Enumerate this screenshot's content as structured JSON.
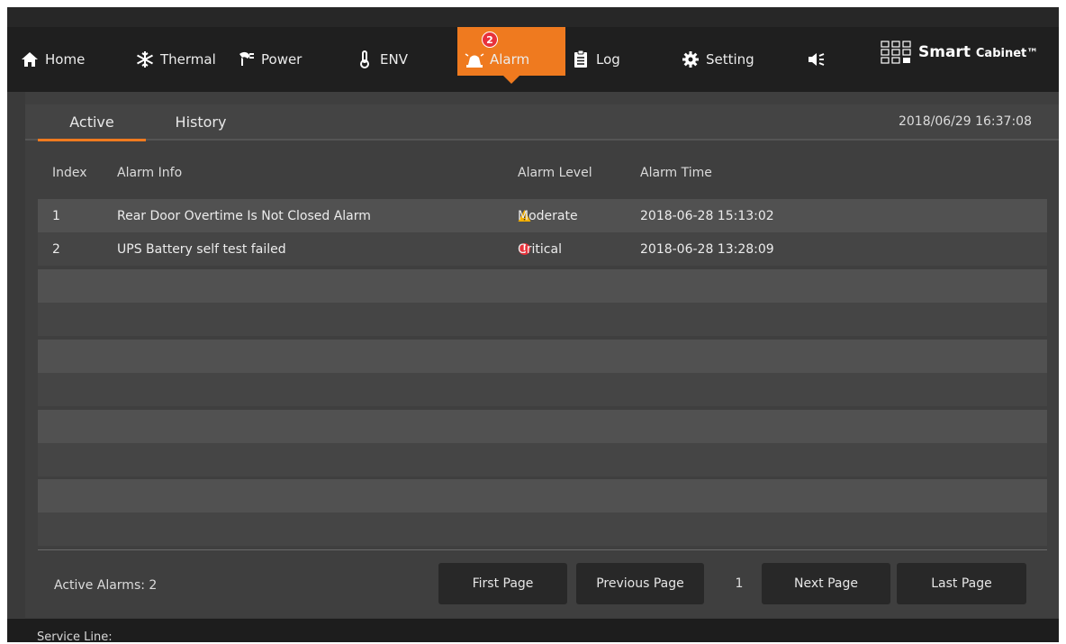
{
  "nav": {
    "items": [
      {
        "label": "Home",
        "icon": "home-icon"
      },
      {
        "label": "Thermal",
        "icon": "snowflake-icon"
      },
      {
        "label": "Power",
        "icon": "plug-icon"
      },
      {
        "label": "ENV",
        "icon": "thermometer-icon"
      },
      {
        "label": "Alarm",
        "icon": "siren-icon",
        "active": true
      },
      {
        "label": "Log",
        "icon": "clipboard-icon"
      },
      {
        "label": "Setting",
        "icon": "gear-icon"
      }
    ],
    "alarm_badge": "2",
    "sound_icon": "speaker-mute-icon",
    "brand": {
      "smart": "Smart",
      "cabinet": "Cabinet™"
    },
    "accent_color": "#ef7a1f"
  },
  "tabs": [
    {
      "label": "Active",
      "active": true
    },
    {
      "label": "History",
      "active": false
    }
  ],
  "datetime": "2018/06/29 16:37:08",
  "table": {
    "columns": [
      "Index",
      "Alarm Info",
      "Alarm Level",
      "Alarm Time"
    ],
    "rows": [
      {
        "index": "1",
        "info": "Rear Door Overtime Is Not Closed Alarm",
        "level": "Moderate",
        "level_icon": "warning-triangle-icon",
        "time": "2018-06-28 15:13:02"
      },
      {
        "index": "2",
        "info": "UPS Battery self test failed",
        "level": "Critical",
        "level_icon": "critical-exclamation-icon",
        "time": "2018-06-28 13:28:09"
      }
    ]
  },
  "footer": {
    "active_alarms": "Active Alarms: 2",
    "first_page": "First Page",
    "previous_page": "Previous Page",
    "page_number": "1",
    "next_page": "Next Page",
    "last_page": "Last Page"
  },
  "service_line": "Service Line:"
}
